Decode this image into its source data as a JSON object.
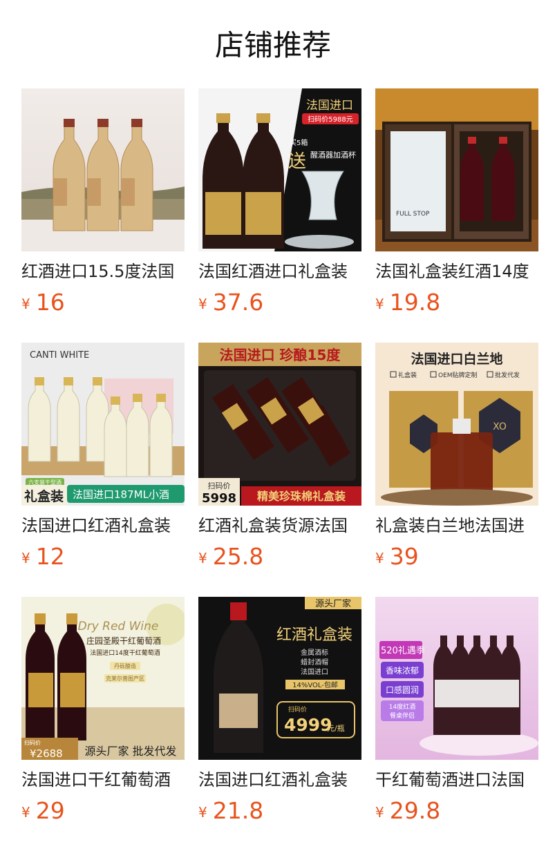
{
  "header": {
    "title": "店铺推荐"
  },
  "currency_symbol": "¥",
  "products": [
    {
      "name": "红酒进口15.5度法国",
      "price": "16",
      "image_text": []
    },
    {
      "name": "法国红酒进口礼盒装",
      "price": "37.6",
      "image_text": [
        "法国进口",
        "扫码价5988元",
        "买5箱",
        "送",
        "醒酒器加酒杯"
      ]
    },
    {
      "name": "法国礼盒装红酒14度",
      "price": "19.8",
      "image_text": [
        "FULL STOP"
      ]
    },
    {
      "name": "法国进口红酒礼盒装",
      "price": "12",
      "image_text": [
        "CANTI WHITE",
        "六支装干型酒",
        "礼盒装",
        "法国进口187ML小酒"
      ]
    },
    {
      "name": "红酒礼盒装货源法国",
      "price": "25.8",
      "image_text": [
        "法国进口 珍酿15度",
        "扫码价",
        "5998",
        "精美珍珠棉礼盒装"
      ]
    },
    {
      "name": "礼盒装白兰地法国进",
      "price": "39",
      "image_text": [
        "法国进口白兰地",
        "礼盒装",
        "OEM贴牌定制",
        "批发代发",
        "XO"
      ]
    },
    {
      "name": "法国进口干红葡萄酒",
      "price": "29",
      "image_text": [
        "Dry Red Wine",
        "庄园圣殿干红葡萄酒",
        "法国进口14度干红葡萄酒",
        "丹砾酿造",
        "克莱尔普图产区",
        "扫码价",
        "¥2688",
        "源头厂家 批发代发"
      ]
    },
    {
      "name": "法国进口红酒礼盒装",
      "price": "21.8",
      "image_text": [
        "源头厂家",
        "红酒礼盒装",
        "金属酒标",
        "蜡封酒帽",
        "法国进口",
        "14%VOL-包邮",
        "扫码价",
        "4999",
        "元/瓶"
      ]
    },
    {
      "name": "干红葡萄酒进口法国",
      "price": "29.8",
      "image_text": [
        "520礼遇季",
        "香味浓郁",
        "口感圆润",
        "14度红酒",
        "餐桌伴侣"
      ]
    }
  ],
  "colors": {
    "price": "#e8531d",
    "title": "#111111",
    "name": "#222222"
  }
}
